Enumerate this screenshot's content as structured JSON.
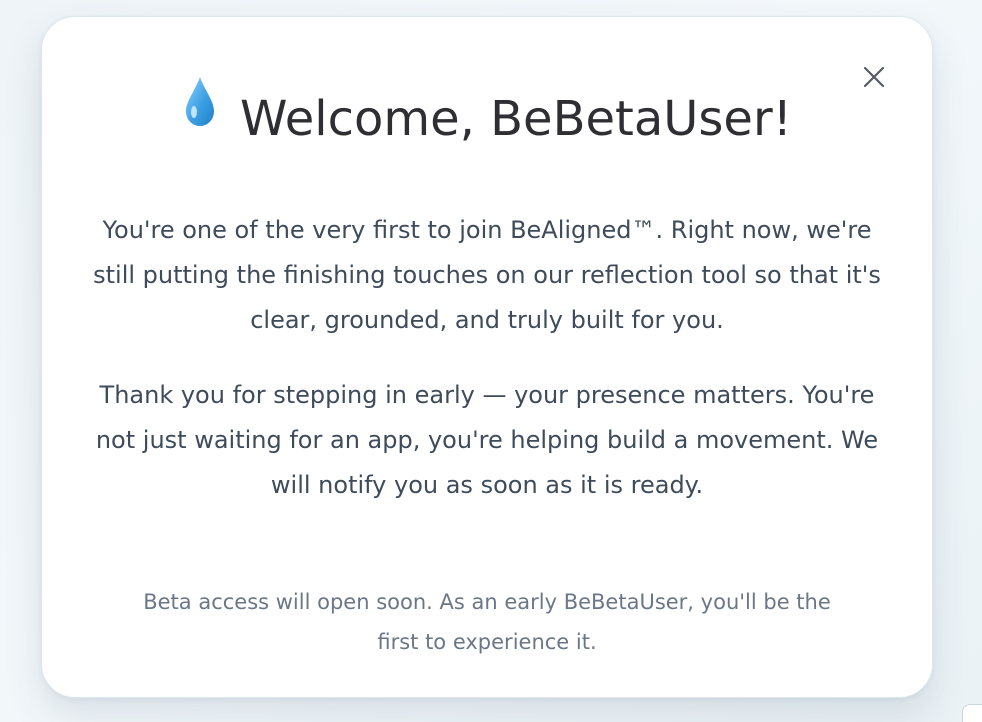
{
  "modal": {
    "icon": "droplet-icon",
    "title": "Welcome, BeBetaUser!",
    "close_icon": "close-icon",
    "paragraph1": "You're one of the very first to join BeAligned™. Right now, we're still putting the finishing touches on our reflection tool so that it's clear, grounded, and truly built for you.",
    "paragraph2": "Thank you for stepping in early — your presence matters. You're not just waiting for an app, you're helping build a movement. We will notify you as soon as it is ready.",
    "note": "Beta access will open soon. As an early BeBetaUser, you'll be the first to experience it."
  },
  "colors": {
    "modal_bg": "#ffffff",
    "title": "#2f2f33",
    "body_text": "#3e4b5b",
    "note_text": "#6b7787",
    "droplet": "#4aa8e6",
    "close_icon": "#555c66"
  }
}
